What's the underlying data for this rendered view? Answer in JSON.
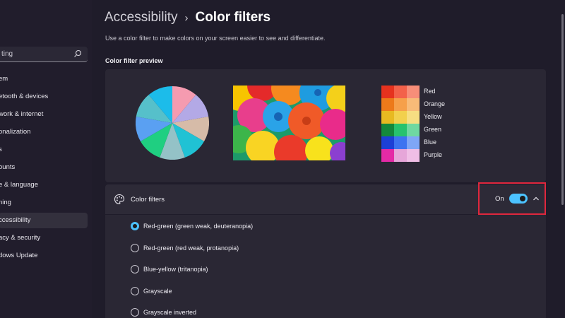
{
  "sidebar": {
    "search_value": "ting",
    "items": [
      {
        "label": "em"
      },
      {
        "label": "etooth & devices"
      },
      {
        "label": "work & internet"
      },
      {
        "label": "onalization"
      },
      {
        "label": "s"
      },
      {
        "label": "ounts"
      },
      {
        "label": "e & language"
      },
      {
        "label": "ning"
      },
      {
        "label": "ccessibility"
      },
      {
        "label": "acy & security"
      },
      {
        "label": "dows Update"
      }
    ],
    "active_index": 8
  },
  "breadcrumb": {
    "parent": "Accessibility",
    "separator": "›",
    "current": "Color filters"
  },
  "description": "Use a color filter to make colors on your screen easier to see and differentiate.",
  "preview": {
    "title": "Color filter preview",
    "pie_colors": [
      "#f59bb0",
      "#b3a9e6",
      "#d6bba8",
      "#20c2d4",
      "#94c2c7",
      "#1fcf81",
      "#5aa0f2",
      "#56c0ca",
      "#1cbcea"
    ],
    "swatches": [
      {
        "label": "Red",
        "colors": [
          "#e6321e",
          "#f3614a",
          "#f78e79"
        ]
      },
      {
        "label": "Orange",
        "colors": [
          "#ed7a1a",
          "#f6a04a",
          "#f8bb78"
        ]
      },
      {
        "label": "Yellow",
        "colors": [
          "#e8b921",
          "#f2d04d",
          "#f6de82"
        ]
      },
      {
        "label": "Green",
        "colors": [
          "#14883c",
          "#27c26e",
          "#6fd8a1"
        ]
      },
      {
        "label": "Blue",
        "colors": [
          "#1c3fd6",
          "#3d73f0",
          "#7fa6f6"
        ]
      },
      {
        "label": "Purple",
        "colors": [
          "#e42aa6",
          "#e6a6d9",
          "#f0bee6"
        ]
      }
    ]
  },
  "color_filters": {
    "label": "Color filters",
    "state_label": "On",
    "enabled": true,
    "options": [
      {
        "label": "Red-green (green weak, deuteranopia)",
        "checked": true
      },
      {
        "label": "Red-green (red weak, protanopia)",
        "checked": false
      },
      {
        "label": "Blue-yellow (tritanopia)",
        "checked": false
      },
      {
        "label": "Grayscale",
        "checked": false
      },
      {
        "label": "Grayscale inverted",
        "checked": false
      }
    ]
  },
  "colors": {
    "accent": "#4cc2ff",
    "highlight_box": "#e0273d"
  }
}
